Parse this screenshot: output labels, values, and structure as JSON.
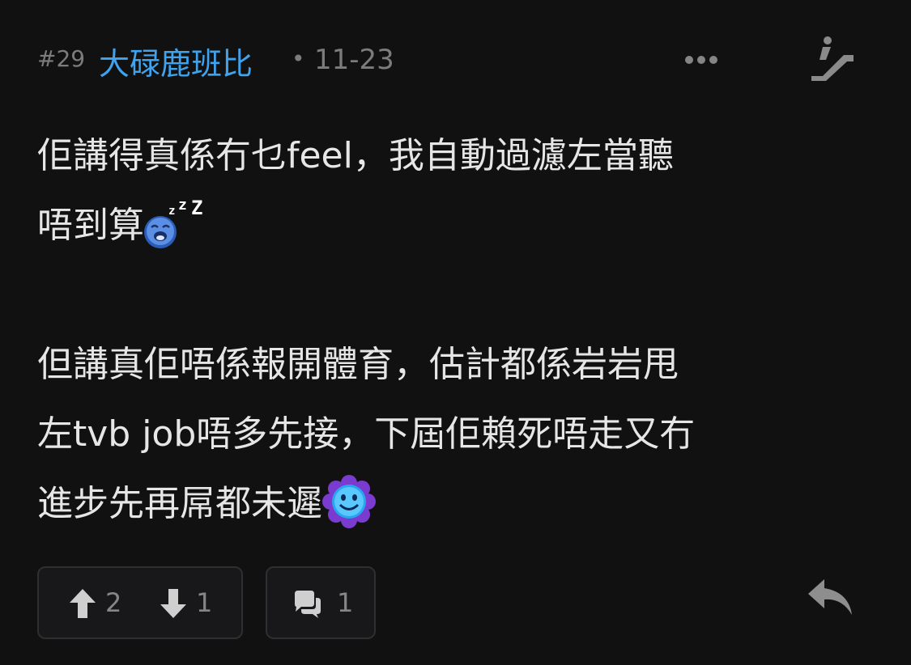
{
  "post": {
    "floor": "#29",
    "username": "大碌鹿班比",
    "separator": "•",
    "time": "11-23",
    "content": {
      "line1": "佢講得真係冇乜feel，我自動過濾左當聽",
      "line2": "唔到算",
      "line3": "但講真佢唔係報開體育，估計都係岩岩甩",
      "line4": "左tvb job唔多先接，下屆佢賴死唔走又冇",
      "line5": "進步先再屌都未遲"
    },
    "emojis": {
      "first": "sleeping-face",
      "second": "smiling-flower"
    }
  },
  "actions": {
    "upvotes": "2",
    "downvotes": "1",
    "comments": "1"
  },
  "icons": {
    "more": "ellipsis-icon",
    "escalator": "escalator-icon",
    "upvote": "arrow-up-icon",
    "downvote": "arrow-down-icon",
    "comment": "chat-bubble-icon",
    "reply": "reply-icon"
  },
  "colors": {
    "background": "#111112",
    "username": "#3fa3ee",
    "meta": "#7c7c7c",
    "text": "#e6e6e6",
    "box_border": "#2f2f31"
  }
}
